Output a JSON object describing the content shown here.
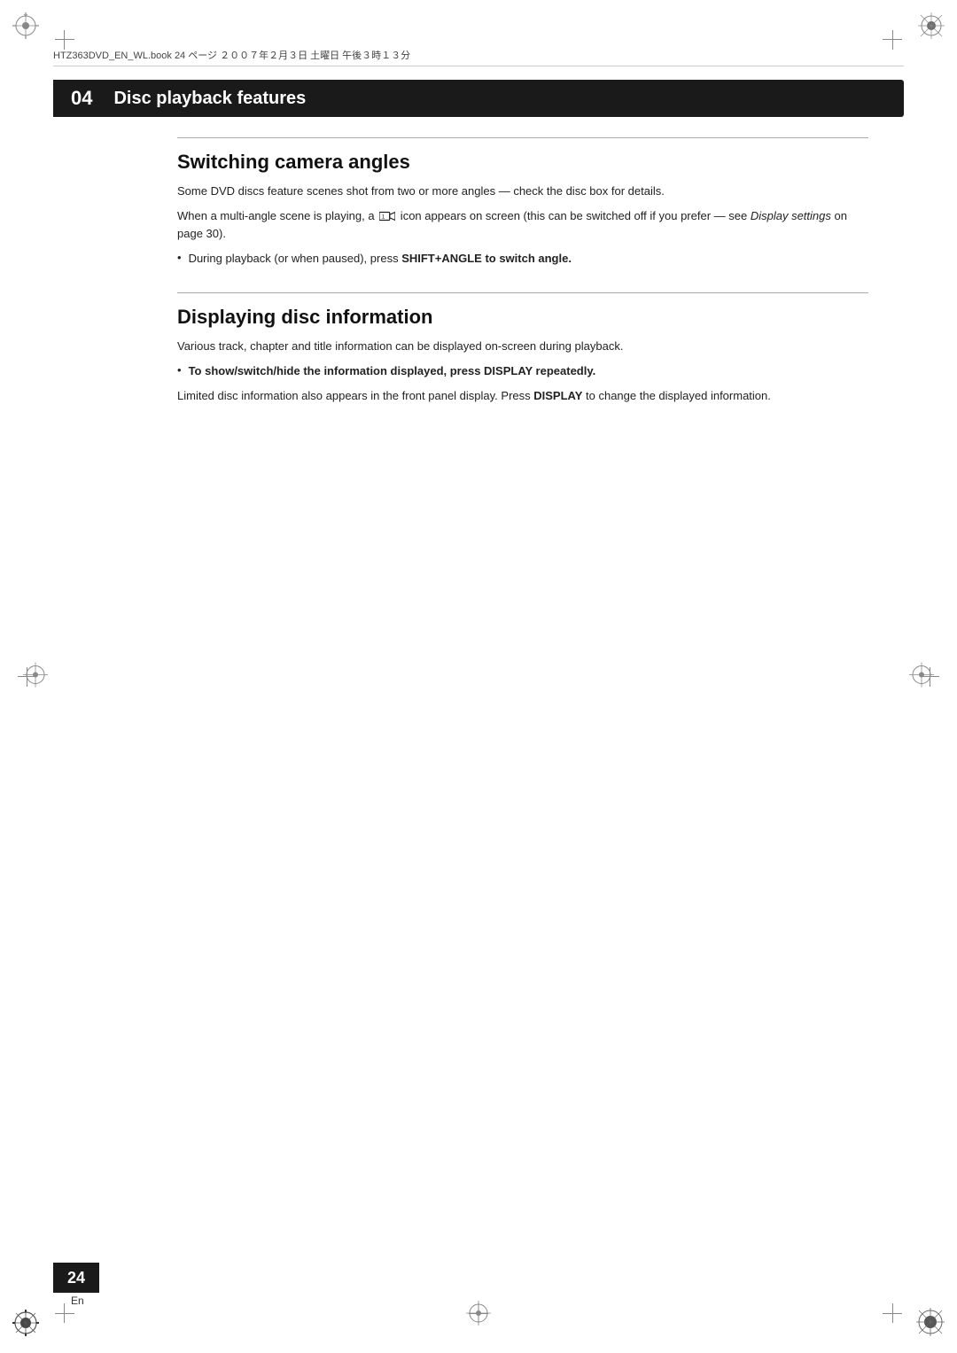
{
  "page": {
    "background": "#ffffff",
    "metadata": "HTZ363DVD_EN_WL.book   24 ページ   ２００７年２月３日   土曜日   午後３時１３分",
    "page_number": "24",
    "page_lang": "En"
  },
  "header": {
    "chapter_number": "04",
    "title": "Disc playback features"
  },
  "sections": [
    {
      "id": "switching-camera-angles",
      "title": "Switching camera angles",
      "paragraphs": [
        "Some DVD discs feature scenes shot from two or more angles — check the disc box for details.",
        "When a multi-angle scene is playing, a [icon] icon appears on screen (this can be switched off if you prefer — see Display settings on page 30)."
      ],
      "paragraph2_italic_part": "Display settings",
      "bullet": {
        "prefix": "During playback (or when paused), press ",
        "strong": "SHIFT+ANGLE to switch angle."
      }
    },
    {
      "id": "displaying-disc-information",
      "title": "Displaying disc information",
      "paragraphs": [
        "Various track, chapter and title information can be displayed on-screen during playback."
      ],
      "bullet": {
        "prefix": "To show/switch/hide the information displayed, press ",
        "strong": "DISPLAY",
        "suffix": " repeatedly."
      },
      "sub_paragraph": "Limited disc information also appears in the front panel display. Press DISPLAY to change the displayed information.",
      "sub_paragraph_bold": "DISPLAY"
    }
  ]
}
